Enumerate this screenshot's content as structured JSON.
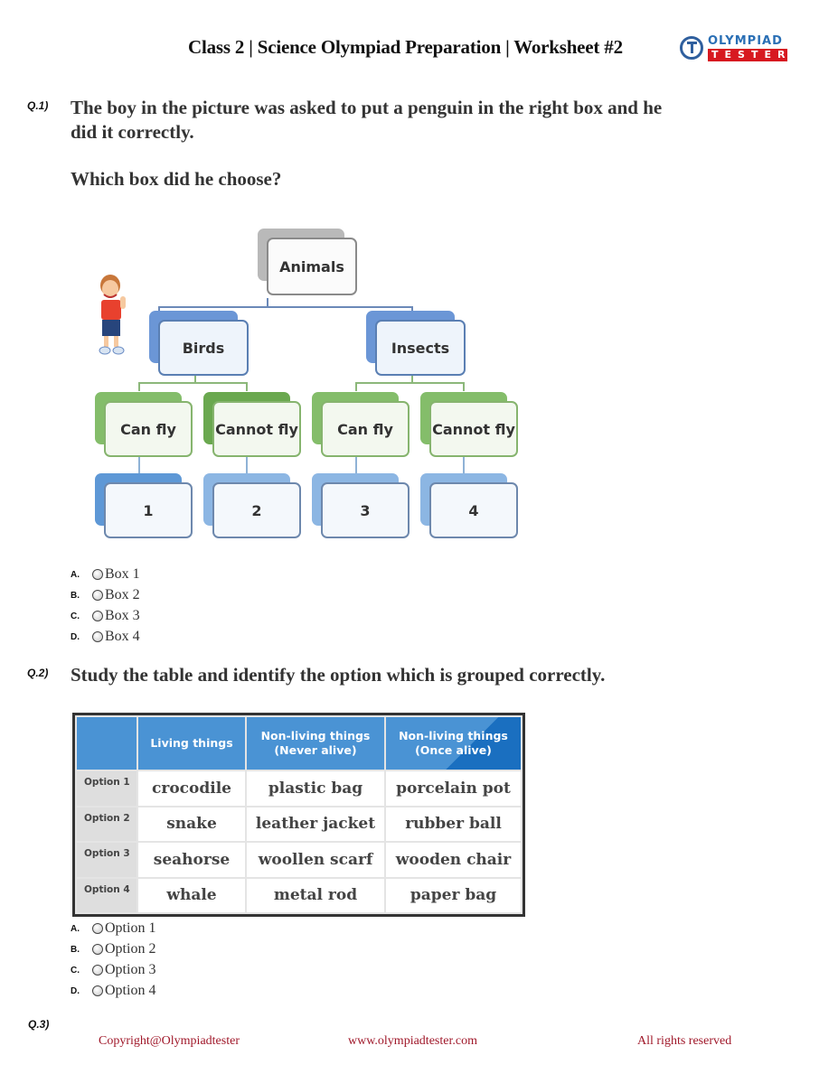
{
  "header": {
    "title": "Class 2 | Science Olympiad Preparation | Worksheet #2",
    "logo": {
      "line1": "OLYMPIAD",
      "line2": "TESTER",
      "icon": "power-ring-icon"
    }
  },
  "questions": [
    {
      "number": "Q.1)",
      "text_line1": "The boy in the picture was asked to put a penguin in the right box and he",
      "text_line2": "did it correctly.",
      "prompt": "Which box did he choose?",
      "diagram": {
        "root": "Animals",
        "level1": [
          "Birds",
          "Insects"
        ],
        "level2": [
          "Can fly",
          "Cannot fly",
          "Can fly",
          "Cannot fly"
        ],
        "boxes": [
          "1",
          "2",
          "3",
          "4"
        ],
        "figure": "boy-thumbs-up"
      },
      "options": [
        {
          "letter": "A.",
          "label": "Box 1"
        },
        {
          "letter": "B.",
          "label": "Box 2"
        },
        {
          "letter": "C.",
          "label": "Box 3"
        },
        {
          "letter": "D.",
          "label": "Box 4"
        }
      ]
    },
    {
      "number": "Q.2)",
      "text": "Study the table and identify the option which is grouped correctly.",
      "table": {
        "headers": [
          "",
          "Living things",
          "Non-living things\n(Never alive)",
          "Non-living things\n(Once alive)"
        ],
        "header_lines": [
          [
            "",
            ""
          ],
          [
            "Living things",
            ""
          ],
          [
            "Non-living things",
            "(Never alive)"
          ],
          [
            "Non-living things",
            "(Once alive)"
          ]
        ],
        "rows": [
          {
            "label": "Option 1",
            "cells": [
              "crocodile",
              "plastic bag",
              "porcelain pot"
            ]
          },
          {
            "label": "Option 2",
            "cells": [
              "snake",
              "leather jacket",
              "rubber ball"
            ]
          },
          {
            "label": "Option 3",
            "cells": [
              "seahorse",
              "woollen scarf",
              "wooden chair"
            ]
          },
          {
            "label": "Option 4",
            "cells": [
              "whale",
              "metal rod",
              "paper bag"
            ]
          }
        ]
      },
      "options": [
        {
          "letter": "A.",
          "label": "Option 1"
        },
        {
          "letter": "B.",
          "label": "Option 2"
        },
        {
          "letter": "C.",
          "label": "Option 3"
        },
        {
          "letter": "D.",
          "label": "Option 4"
        }
      ]
    },
    {
      "number": "Q.3)"
    }
  ],
  "footer": {
    "copyright": "Copyright@Olympiadtester",
    "website": "www.olympiadtester.com",
    "rights": "All rights reserved"
  },
  "colors": {
    "footer_text": "#a0182a",
    "table_header": "#4a93d4",
    "logo_blue": "#2a6fb5",
    "logo_red": "#d71920"
  }
}
